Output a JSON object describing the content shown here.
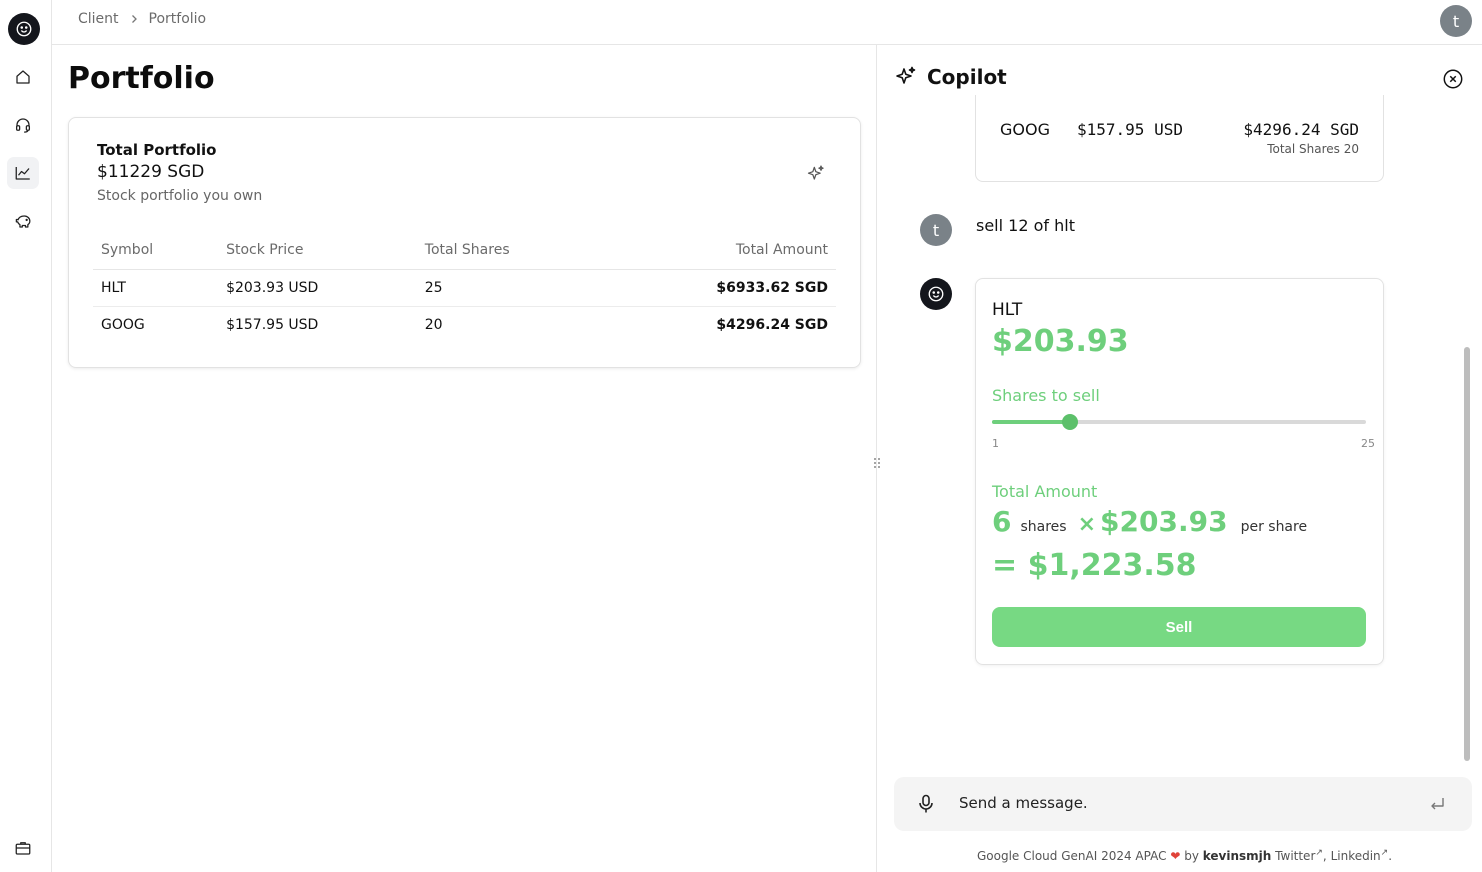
{
  "breadcrumb": [
    "Client",
    "Portfolio"
  ],
  "user": {
    "initial": "t"
  },
  "sidebar": {
    "items": [
      {
        "icon": "home-icon"
      },
      {
        "icon": "headset-icon"
      },
      {
        "icon": "chart-icon",
        "active": true
      },
      {
        "icon": "piggy-bank-icon"
      }
    ],
    "bottom_icon": "briefcase-icon"
  },
  "page": {
    "title": "Portfolio"
  },
  "portfolio_card": {
    "title": "Total Portfolio",
    "total": "$11229 SGD",
    "subtitle": "Stock portfolio you own",
    "columns": [
      "Symbol",
      "Stock Price",
      "Total Shares",
      "Total Amount"
    ],
    "rows": [
      {
        "symbol": "HLT",
        "price": "$203.93 USD",
        "shares": "25",
        "amount": "$6933.62 SGD"
      },
      {
        "symbol": "GOOG",
        "price": "$157.95 USD",
        "shares": "20",
        "amount": "$4296.24 SGD"
      }
    ]
  },
  "copilot": {
    "title": "Copilot",
    "previous_card": {
      "symbol": "GOOG",
      "price": "$157.95 USD",
      "amount": "$4296.24 SGD",
      "shares_label": "Total Shares 20"
    },
    "user_message": "sell 12 of hlt",
    "sell_card": {
      "symbol": "HLT",
      "price": "$203.93",
      "shares_label": "Shares to sell",
      "slider": {
        "min": "1",
        "max": "25",
        "value": 6
      },
      "total_label": "Total Amount",
      "shares": "6",
      "shares_word": "shares",
      "times": "×",
      "per_share_price": "$203.93",
      "per_share_word": "per share",
      "total": "= $1,223.58",
      "button": "Sell"
    },
    "composer": {
      "placeholder": "Send a message."
    },
    "footer": {
      "prefix": "Google Cloud GenAI 2024 APAC",
      "by": "by",
      "author": "kevinsmjh",
      "twitter": "Twitter",
      "linkedin": "Linkedin",
      "suffix": "."
    }
  },
  "colors": {
    "accent_green": "#6ecf7c",
    "button_green": "#77d983",
    "dark": "#14161c",
    "avatar_grey": "#7a8288"
  }
}
